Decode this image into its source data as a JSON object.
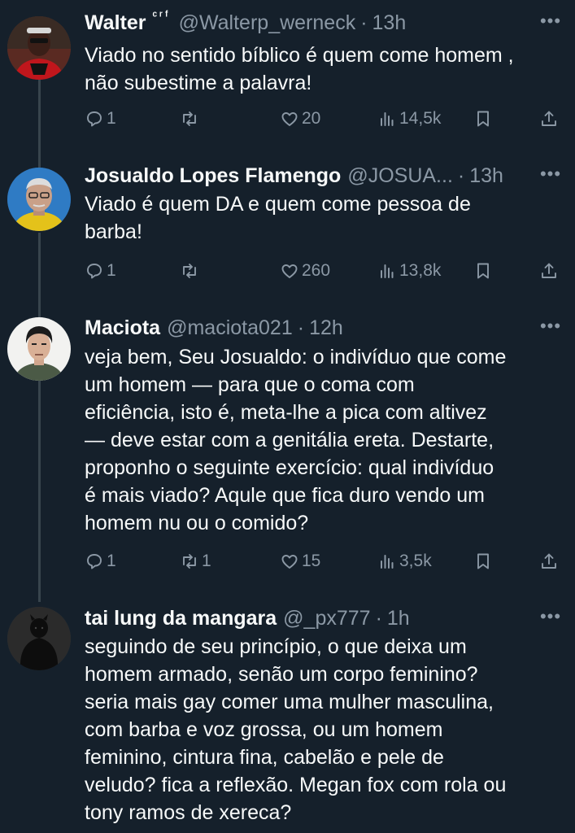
{
  "tweets": [
    {
      "name": "Walter",
      "flag": "ᶜʳᶠ",
      "handle": "@Walterp_werneck",
      "time": "13h",
      "text": "Viado no sentido bíblico é quem come homem ,\nnão subestime a palavra!",
      "replies": "1",
      "retweets": "",
      "likes": "20",
      "views": "14,5k"
    },
    {
      "name": "Josualdo Lopes Flamengo",
      "flag": "",
      "handle": "@JOSUA...",
      "time": "13h",
      "text": "Viado é quem DA e quem come pessoa de\nbarba!",
      "replies": "1",
      "retweets": "",
      "likes": "260",
      "views": "13,8k"
    },
    {
      "name": "Maciota",
      "flag": "",
      "handle": "@maciota021",
      "time": "12h",
      "text": "veja bem, Seu Josualdo: o indivíduo que come\num homem — para que o coma com\neficiência, isto é, meta-lhe a pica com altivez\n— deve estar com a genitália ereta. Destarte,\nproponho o seguinte exercício: qual indivíduo\né mais viado? Aqule que fica duro vendo um\nhomem nu ou o comido?",
      "replies": "1",
      "retweets": "1",
      "likes": "15",
      "views": "3,5k"
    },
    {
      "name": "tai lung da mangara",
      "flag": "",
      "handle": "@_px777",
      "time": "1h",
      "text": "seguindo de seu princípio, o que deixa um\nhomem armado, senão um corpo feminino?\nseria mais gay comer uma mulher masculina,\ncom barba e voz grossa, ou um homem\nfeminino, cintura fina, cabelão e pele de\nveludo? fica a reflexão. Megan fox com rola ou\ntony ramos de xereca?",
      "replies": "",
      "retweets": "",
      "likes": "",
      "views": ""
    }
  ],
  "ui": {
    "dot": "·",
    "more": "•••"
  },
  "icons": {
    "reply": "reply-icon",
    "retweet": "retweet-icon",
    "like": "heart-icon",
    "views": "views-icon",
    "bookmark": "bookmark-icon",
    "share": "share-icon",
    "more": "more-icon"
  },
  "colors": {
    "background": "#15202b",
    "text": "#f7f9f9",
    "secondary": "#8b98a5",
    "thread_line": "#38444d"
  }
}
